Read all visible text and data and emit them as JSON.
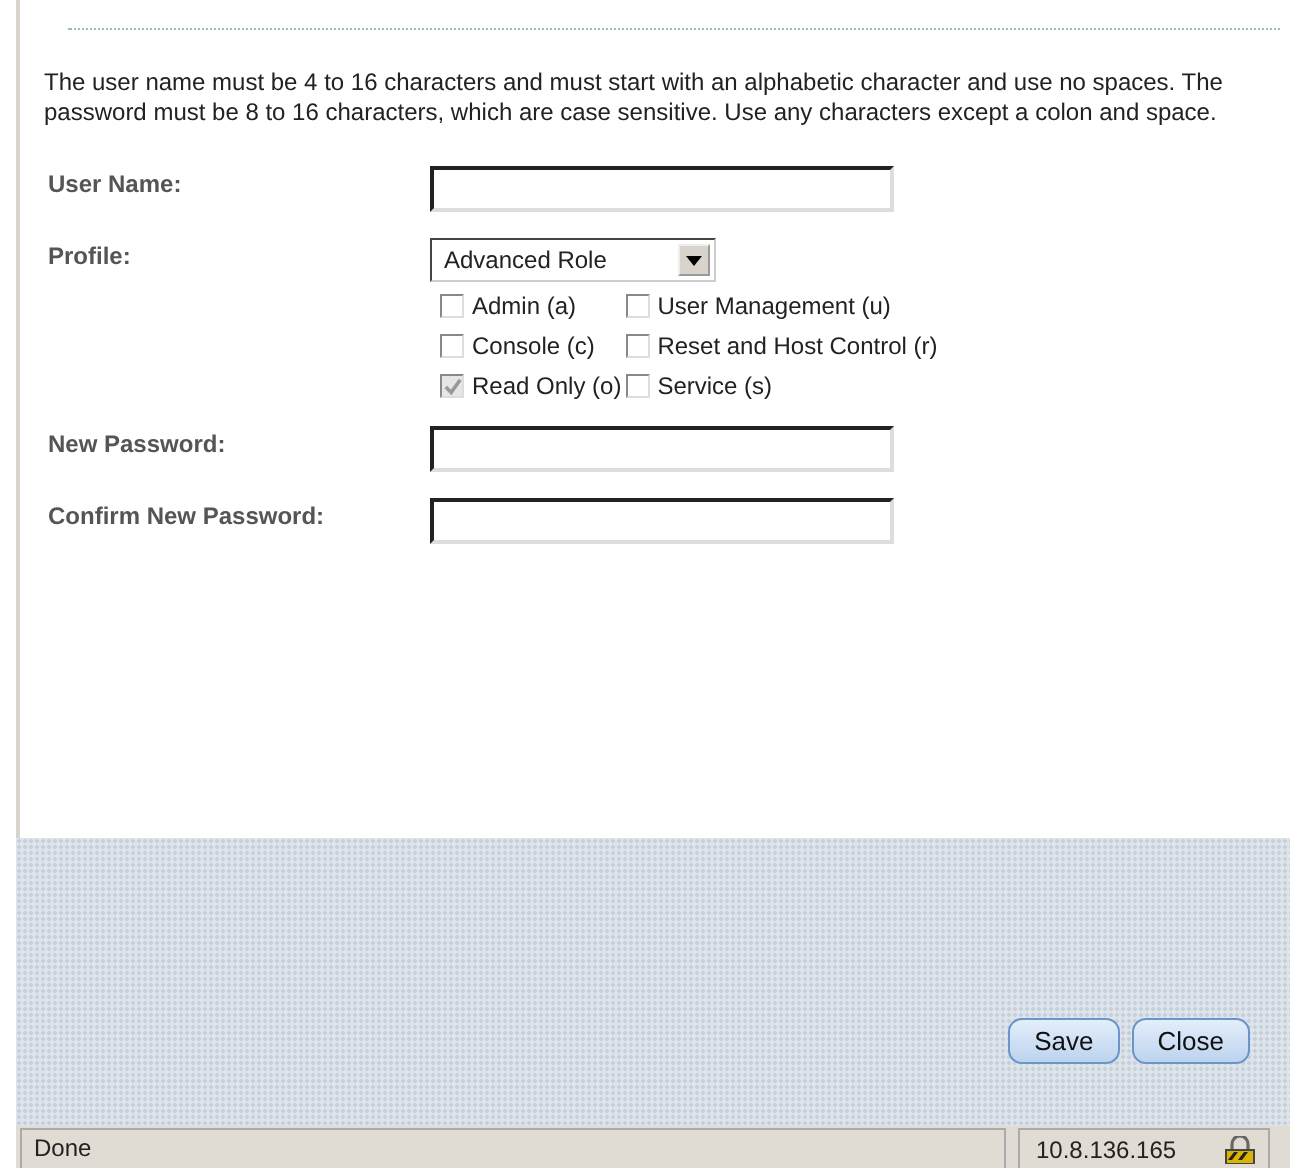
{
  "instructions": "The user name must be 4 to 16 characters and must start with an alphabetic character and use no spaces. The password must be 8 to 16 characters, which are case sensitive. Use any characters except a colon and space.",
  "fields": [
    {
      "label": "User Name:",
      "kind": "text"
    },
    {
      "label": "Profile:",
      "kind": "select",
      "value": "Advanced Role",
      "options": [
        {
          "label": "Admin (a)",
          "checked": false,
          "disabled": false
        },
        {
          "label": "User Management (u)",
          "checked": false,
          "disabled": false
        },
        {
          "label": "Console (c)",
          "checked": false,
          "disabled": false
        },
        {
          "label": "Reset and Host Control (r)",
          "checked": false,
          "disabled": false
        },
        {
          "label": "Read Only (o)",
          "checked": true,
          "disabled": true
        },
        {
          "label": "Service (s)",
          "checked": false,
          "disabled": false
        }
      ]
    },
    {
      "label": "New Password:",
      "kind": "text"
    },
    {
      "label": "Confirm New Password:",
      "kind": "text"
    }
  ],
  "buttons": [
    "Save",
    "Close"
  ],
  "status_bar": {
    "status": "Done",
    "address": "10.8.136.165"
  }
}
